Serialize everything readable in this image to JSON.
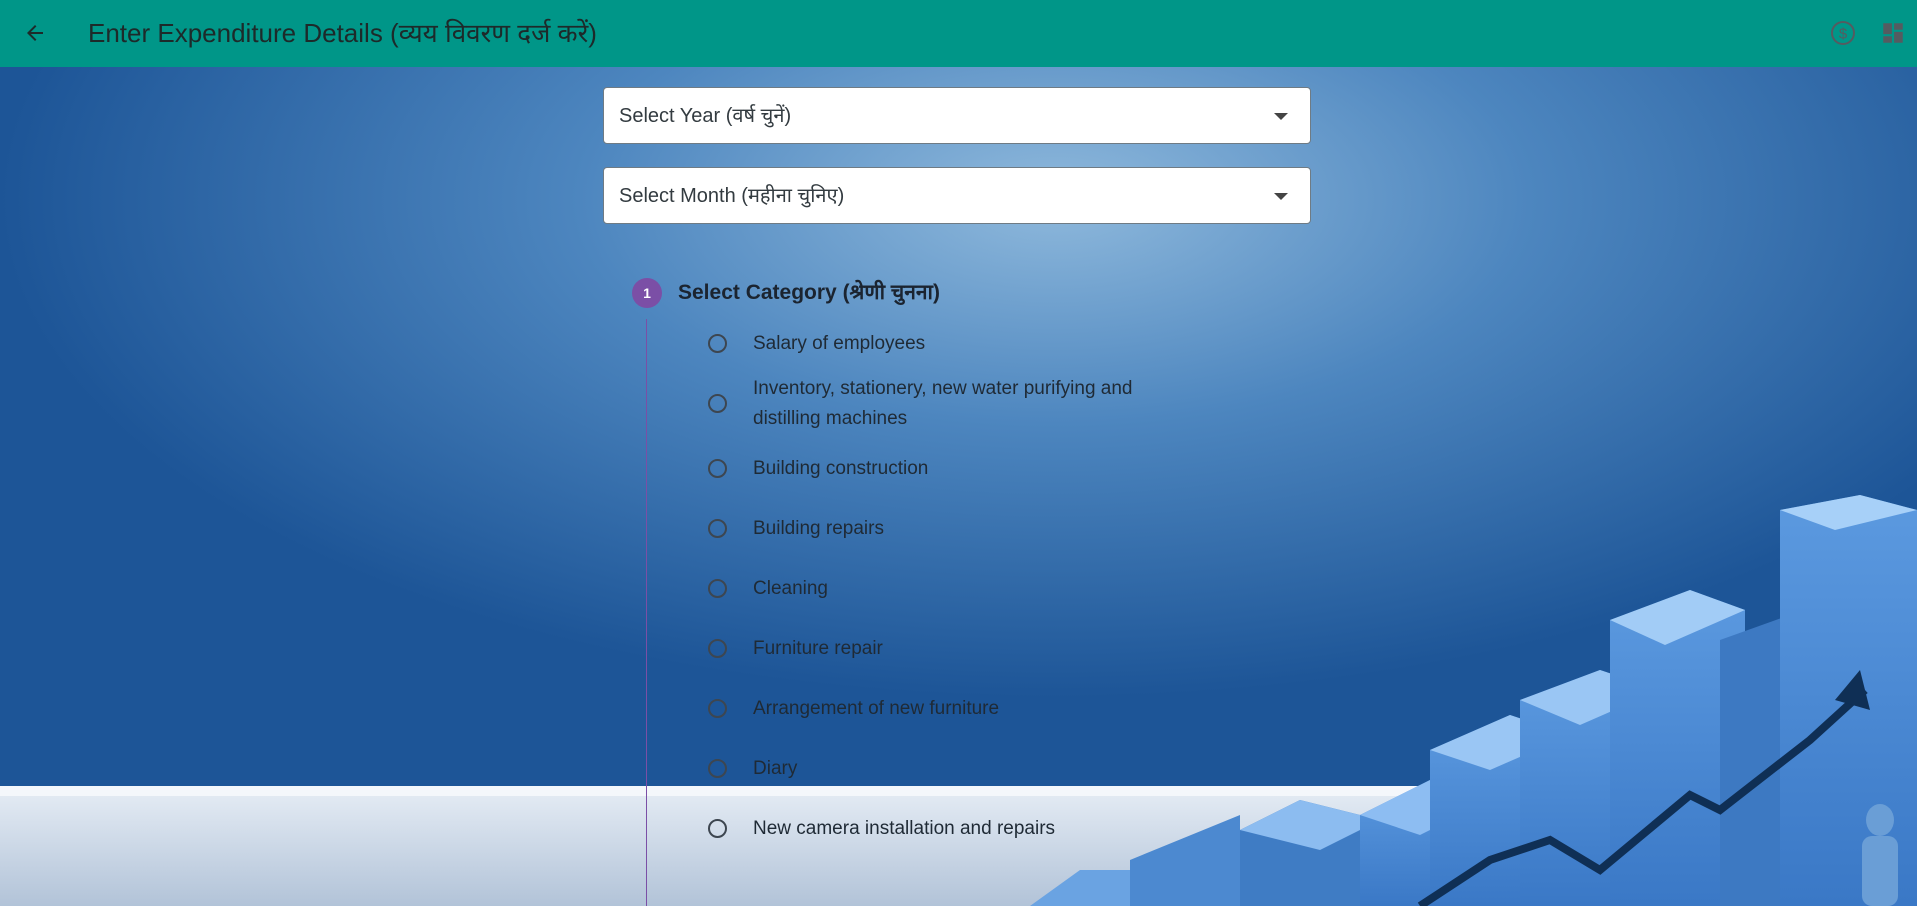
{
  "appbar": {
    "title": "Enter Expenditure Details (व्यय विवरण दर्ज करें)",
    "back_icon": "arrow-back-icon",
    "actions": [
      "currency-icon",
      "dashboard-icon"
    ],
    "color": "#009688"
  },
  "form": {
    "year": {
      "placeholder": "Select Year (वर्ष चुनें)"
    },
    "month": {
      "placeholder": "Select Month (महीना चुनिए)"
    }
  },
  "step": {
    "number": "1",
    "title": "Select Category (श्रेणी चुनना)",
    "color": "#7b4fa6",
    "options": [
      "Salary of employees",
      "Inventory, stationery, new water purifying and distilling machines",
      "Building construction",
      "Building repairs",
      "Cleaning",
      "Furniture repair",
      "Arrangement of new furniture",
      "Diary",
      "New camera installation and repairs"
    ]
  }
}
